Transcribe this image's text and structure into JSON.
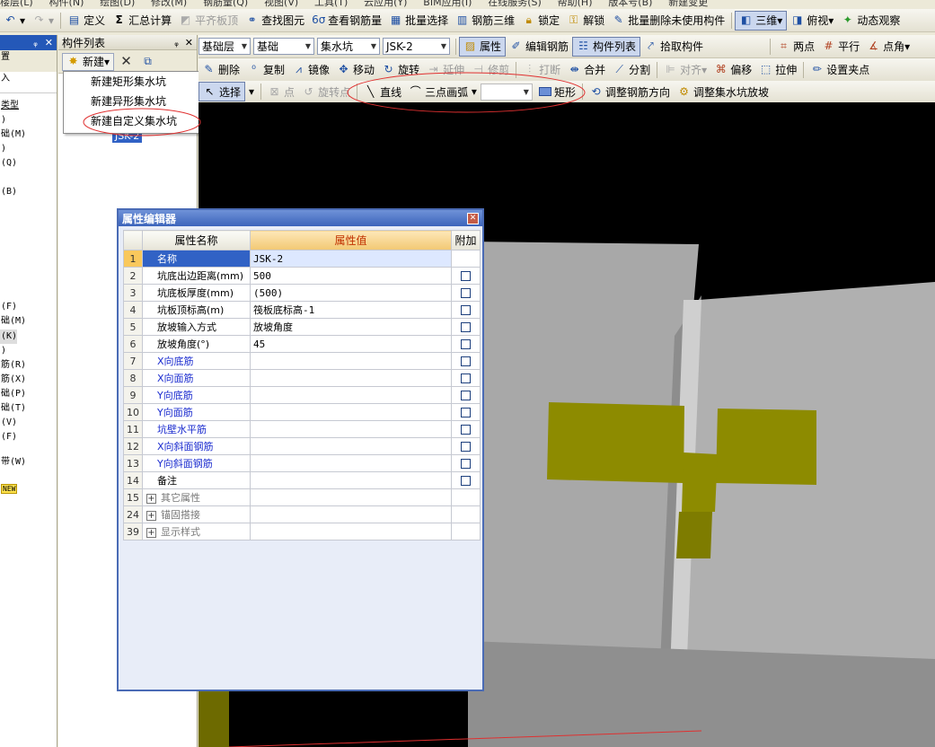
{
  "menubar": [
    "楼层(L)",
    "构件(N)",
    "绘图(D)",
    "修改(M)",
    "钢筋量(Q)",
    "视图(V)",
    "工具(T)",
    "云应用(Y)",
    "BIM应用(I)",
    "在线服务(S)",
    "帮助(H)",
    "版本号(B)",
    "新建变更"
  ],
  "toolbar1": {
    "define": "定义",
    "summary": "汇总计算",
    "flush_slab": "平齐板顶",
    "find": "查找图元",
    "view_rebar": "查看钢筋量",
    "batch_select": "批量选择",
    "rebar_3d": "钢筋三维",
    "lock": "锁定",
    "unlock": "解锁",
    "batch_delete": "批量删除未使用构件",
    "view3d": "三维",
    "topview": "俯视",
    "dynamic": "动态观察"
  },
  "toolbar2": {
    "floor": "基础层",
    "category": "基础",
    "type": "集水坑",
    "component": "JSK-2",
    "properties": "属性",
    "edit_rebar": "编辑钢筋",
    "component_list": "构件列表",
    "pick": "拾取构件",
    "two_point": "两点",
    "parallel": "平行",
    "point_angle": "点角"
  },
  "toolbar3": {
    "delete": "删除",
    "copy": "复制",
    "mirror": "镜像",
    "move": "移动",
    "rotate": "旋转",
    "extend": "延伸",
    "trim": "修剪",
    "break": "打断",
    "merge": "合并",
    "split": "分割",
    "align": "对齐",
    "offset": "偏移",
    "stretch": "拉伸",
    "grip": "设置夹点"
  },
  "toolbar4": {
    "select": "选择",
    "point": "点",
    "rotate_point": "旋转点",
    "line": "直线",
    "arc": "三点画弧",
    "rect": "矩形",
    "adjust_rebar_dir": "调整钢筋方向",
    "adjust_slope": "调整集水坑放坡"
  },
  "leftpane": {
    "items": [
      "置",
      "入",
      "类型",
      ")",
      "础(M)",
      ")",
      "(Q)",
      "(B)",
      "(F)",
      "础(M)",
      "(K)",
      ")",
      "筋(R)",
      "筋(X)",
      "础(P)",
      "础(T)",
      "(V)",
      "(F)",
      "带(W)",
      "NEW"
    ]
  },
  "complist": {
    "title": "构件列表",
    "new_label": "新建",
    "selected_item": "JSK-2"
  },
  "dropdown": {
    "items": [
      "新建矩形集水坑",
      "新建异形集水坑",
      "新建自定义集水坑"
    ]
  },
  "propwin": {
    "title": "属性编辑器",
    "headers": {
      "name": "属性名称",
      "value": "属性值",
      "add": "附加"
    },
    "rows": [
      {
        "num": "1",
        "name": "名称",
        "value": "JSK-2"
      },
      {
        "num": "2",
        "name": "坑底出边距离(mm)",
        "value": "500"
      },
      {
        "num": "3",
        "name": "坑底板厚度(mm)",
        "value": "(500)"
      },
      {
        "num": "4",
        "name": "坑板顶标高(m)",
        "value": "筏板底标高-1"
      },
      {
        "num": "5",
        "name": "放坡输入方式",
        "value": "放坡角度"
      },
      {
        "num": "6",
        "name": "放坡角度(°)",
        "value": "45"
      },
      {
        "num": "7",
        "name": "X向底筋",
        "value": ""
      },
      {
        "num": "8",
        "name": "X向面筋",
        "value": ""
      },
      {
        "num": "9",
        "name": "Y向底筋",
        "value": ""
      },
      {
        "num": "10",
        "name": "Y向面筋",
        "value": ""
      },
      {
        "num": "11",
        "name": "坑壁水平筋",
        "value": ""
      },
      {
        "num": "12",
        "name": "X向斜面钢筋",
        "value": ""
      },
      {
        "num": "13",
        "name": "Y向斜面钢筋",
        "value": ""
      },
      {
        "num": "14",
        "name": "备注",
        "value": ""
      },
      {
        "num": "15",
        "name": "其它属性",
        "value": ""
      },
      {
        "num": "24",
        "name": "锚固搭接",
        "value": ""
      },
      {
        "num": "39",
        "name": "显示样式",
        "value": ""
      }
    ]
  },
  "colors": {
    "accent": "#3162c5",
    "annotation_red": "#e03030",
    "model_gray": "#a9a9a9",
    "pit_olive": "#8c8a00"
  }
}
